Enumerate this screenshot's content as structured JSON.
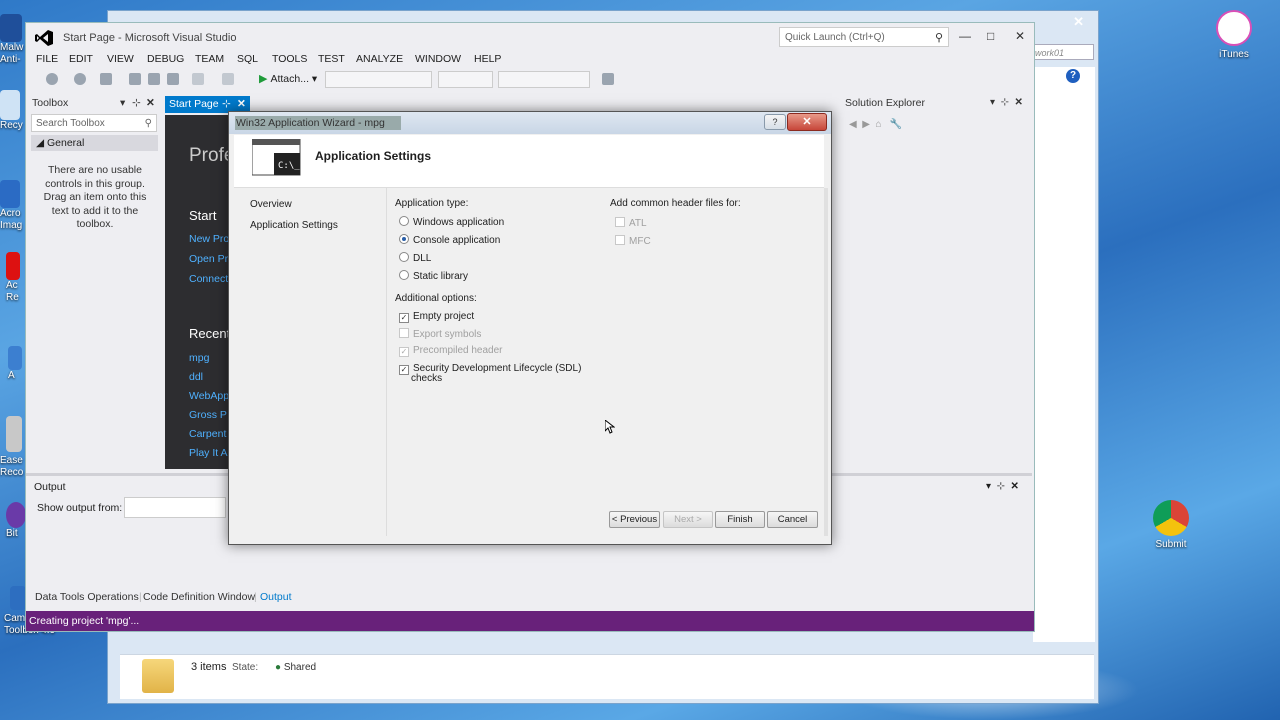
{
  "desktop": {
    "icons": [
      {
        "label": "Malw\nAnti-"
      },
      {
        "label": "Recy"
      },
      {
        "label": "Acro\nImag"
      },
      {
        "label": "Ac\nRe"
      },
      {
        "label": "A"
      },
      {
        "label": "Ease\nReco"
      },
      {
        "label": "Bit"
      },
      {
        "label": "Cam\nToolbox 4.9"
      },
      {
        "label": "iTunes"
      },
      {
        "label": "Submit"
      }
    ]
  },
  "explorer": {
    "item_count": "3 items",
    "state_label": "State:",
    "state_value": "Shared",
    "search_text": "work01"
  },
  "vs": {
    "window_title": "Start Page - Microsoft Visual Studio",
    "quick_launch_placeholder": "Quick Launch (Ctrl+Q)",
    "menu": [
      "FILE",
      "EDIT",
      "VIEW",
      "DEBUG",
      "TEAM",
      "SQL",
      "TOOLS",
      "TEST",
      "ANALYZE",
      "WINDOW",
      "HELP"
    ],
    "attach_label": "Attach...",
    "toolbox": {
      "title": "Toolbox",
      "search_placeholder": "Search Toolbox",
      "group": "General",
      "empty_message": "There are no usable controls in this group. Drag an item onto this text to add it to the toolbox."
    },
    "start_page": {
      "tab_label": "Start Page",
      "heading_partial": "Profe",
      "start_heading": "Start",
      "start_links": [
        "New Pro",
        "Open Pr",
        "Connect"
      ],
      "recent_heading": "Recent",
      "recent_links": [
        "mpg",
        "ddl",
        "WebApp",
        "Gross P",
        "Carpent",
        "Play It A"
      ]
    },
    "solution_explorer": {
      "title": "Solution Explorer"
    },
    "output": {
      "title": "Output",
      "show_output_label": "Show output from:"
    },
    "bottom_tabs": [
      "Data Tools Operations",
      "Code Definition Window",
      "Output"
    ],
    "status_text": "Creating project 'mpg'..."
  },
  "dialog": {
    "title": "Win32 Application Wizard - mpg",
    "header": "Application Settings",
    "nav": [
      "Overview",
      "Application Settings"
    ],
    "app_type_label": "Application type:",
    "app_types": [
      {
        "label": "Windows application",
        "selected": false
      },
      {
        "label": "Console application",
        "selected": true
      },
      {
        "label": "DLL",
        "selected": false
      },
      {
        "label": "Static library",
        "selected": false
      }
    ],
    "additional_label": "Additional options:",
    "additional": [
      {
        "label": "Empty project",
        "checked": true,
        "enabled": true
      },
      {
        "label": "Export symbols",
        "checked": false,
        "enabled": false
      },
      {
        "label": "Precompiled header",
        "checked": true,
        "enabled": false
      },
      {
        "label": "Security Development Lifecycle (SDL)",
        "label2": "checks",
        "checked": true,
        "enabled": true
      }
    ],
    "header_files_label": "Add common header files for:",
    "header_files": [
      {
        "label": "ATL",
        "checked": false,
        "enabled": false
      },
      {
        "label": "MFC",
        "checked": false,
        "enabled": false
      }
    ],
    "buttons": {
      "previous": "< Previous",
      "next": "Next >",
      "finish": "Finish",
      "cancel": "Cancel"
    },
    "help_glyph": "?",
    "close_glyph": "✕"
  },
  "colors": {
    "vs_accent": "#007acc",
    "status_bar": "#68217a",
    "startpage_bg": "#2d2d30",
    "link": "#4fb1ff"
  }
}
